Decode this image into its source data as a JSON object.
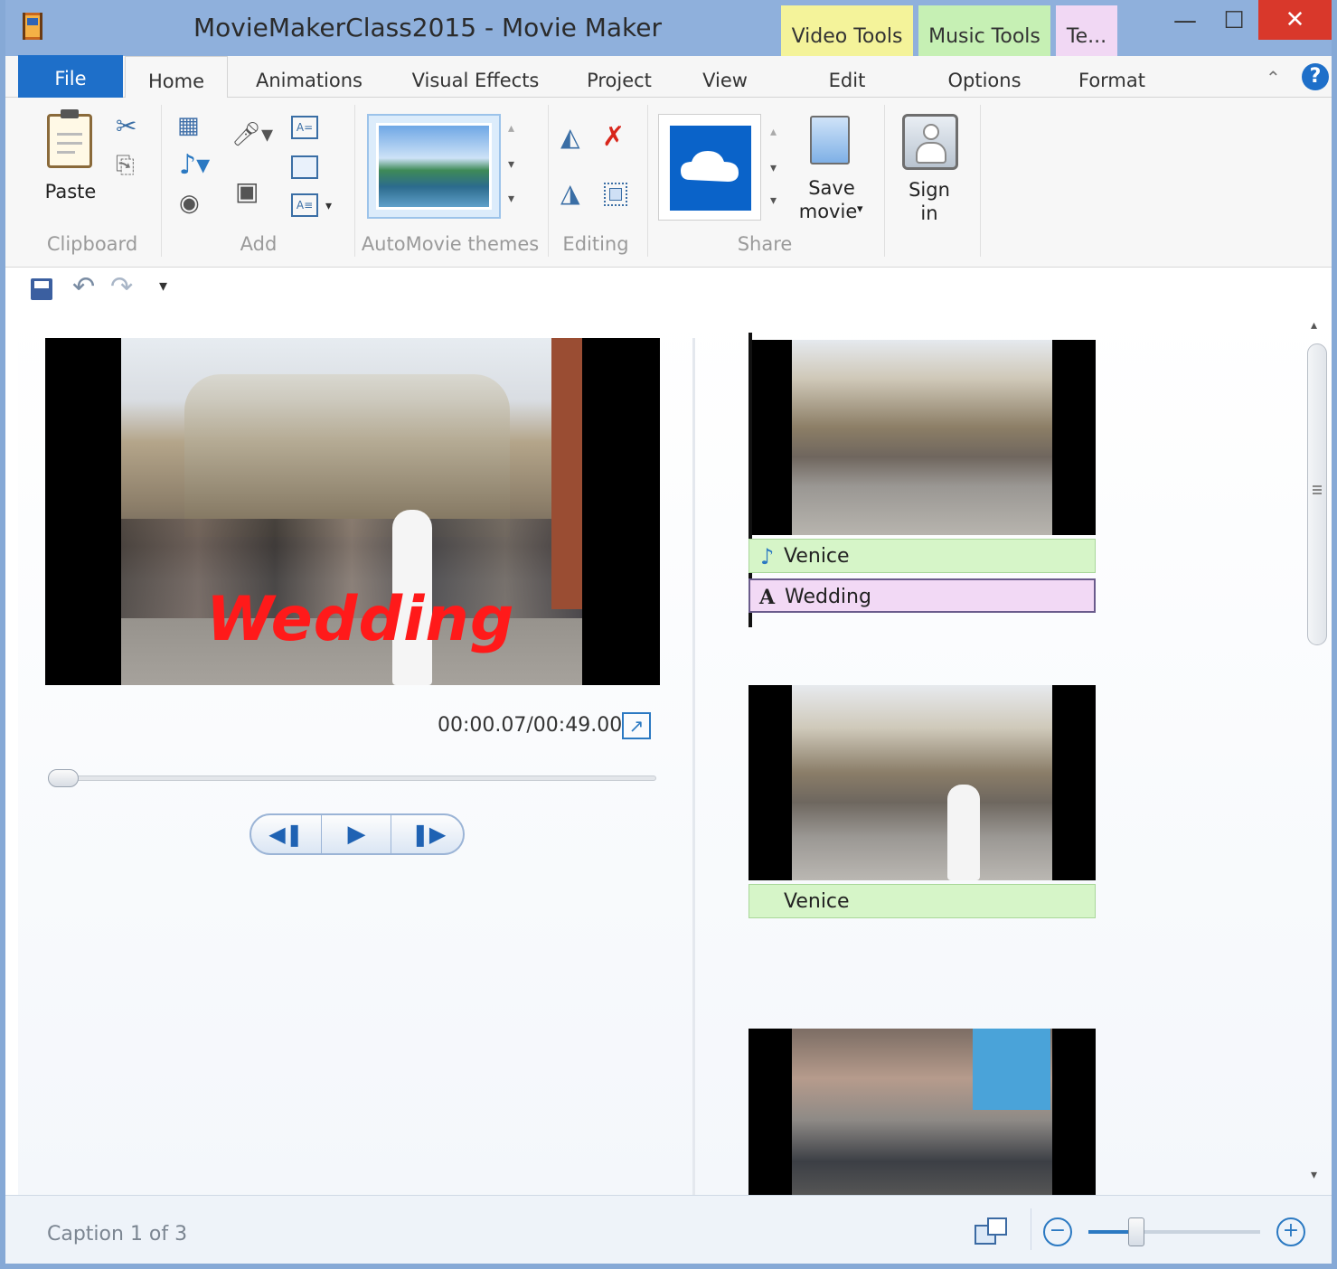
{
  "window": {
    "title": "MovieMakerClass2015 - Movie Maker",
    "minimize_glyph": "—",
    "maximize_glyph": "☐",
    "close_glyph": "✕"
  },
  "context_tabs": [
    {
      "label": "Video Tools",
      "color": "#f4f39a"
    },
    {
      "label": "Music Tools",
      "color": "#c6f0b4"
    },
    {
      "label": "Te...",
      "color": "#f1d8f4"
    }
  ],
  "tabs": {
    "file": "File",
    "home": "Home",
    "animations": "Animations",
    "visual_effects": "Visual Effects",
    "project": "Project",
    "view": "View",
    "edit": "Edit",
    "options": "Options",
    "format": "Format"
  },
  "ribbon": {
    "paste": "Paste",
    "save_movie_line1": "Save",
    "save_movie_line2": "movie",
    "sign_in_line1": "Sign",
    "sign_in_line2": "in",
    "groups": {
      "clipboard": "Clipboard",
      "add": "Add",
      "automovie": "AutoMovie themes",
      "editing": "Editing",
      "share": "Share"
    }
  },
  "preview": {
    "caption_overlay": "Wedding",
    "timecode": "00:00.07/00:49.00",
    "seek_position_fraction": 0.0
  },
  "storyboard": {
    "clips": [
      {
        "music": "Venice",
        "caption": "Wedding",
        "music_icon": "♪",
        "caption_icon": "A"
      },
      {
        "music": "Venice"
      },
      {}
    ]
  },
  "status": {
    "text": "Caption 1 of 3",
    "zoom_fraction": 0.28
  },
  "colors": {
    "file_tab": "#1e6fc9",
    "accent": "#2b79c2",
    "music_bar": "#d6f5c8",
    "caption_bar": "#f2d9f5",
    "overlay_text": "#ff1a1a"
  }
}
